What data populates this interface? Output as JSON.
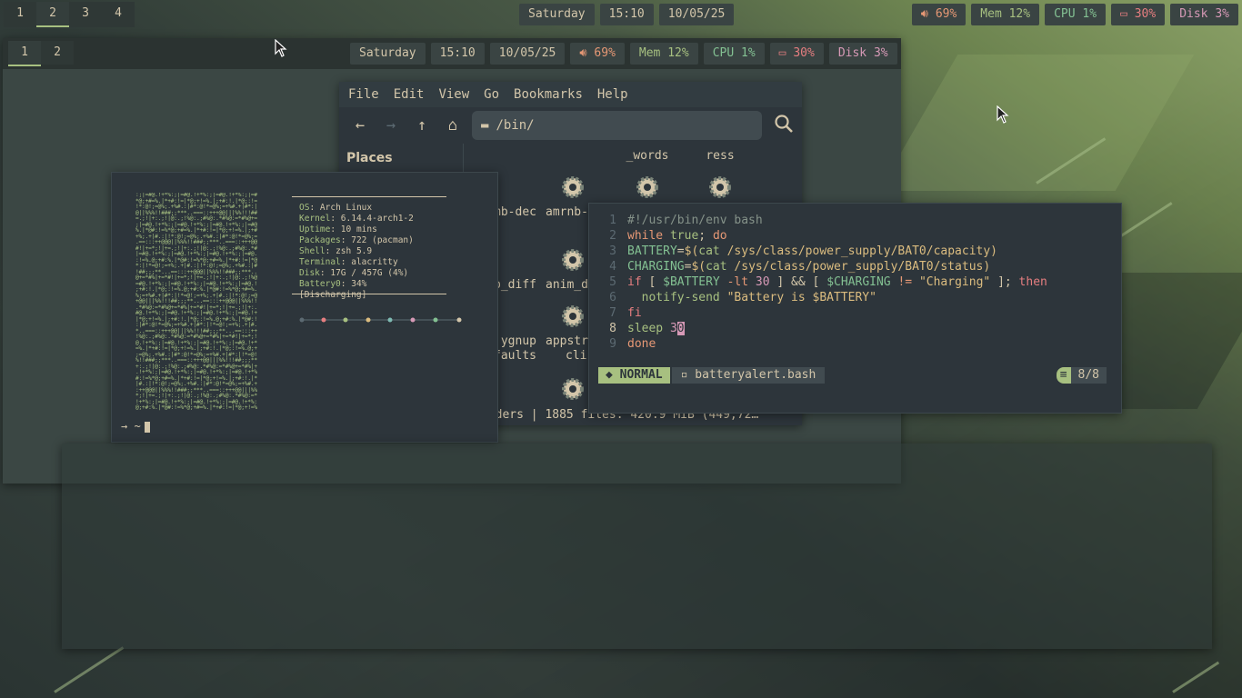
{
  "top_bar": {
    "workspaces": [
      "1",
      "2",
      "3",
      "4"
    ],
    "active_workspace": "2",
    "day": "Saturday",
    "time": "15:10",
    "date": "10/05/25",
    "volume": "69%",
    "mem": "Mem 12%",
    "cpu": "CPU  1%",
    "battery": "30%",
    "disk": "Disk  3%"
  },
  "inner_bar": {
    "workspaces": [
      "1",
      "2"
    ],
    "active_workspace": "1",
    "day": "Saturday",
    "time": "15:10",
    "date": "10/05/25",
    "volume": "69%",
    "mem": "Mem 12%",
    "cpu": "CPU  1%",
    "battery": "30%",
    "disk": "Disk  3%"
  },
  "file_manager": {
    "menu": [
      "File",
      "Edit",
      "View",
      "Go",
      "Bookmarks",
      "Help"
    ],
    "path": "/bin/",
    "sidebar_title": "Places",
    "items": [
      "_words",
      "ress",
      "mb-dec",
      "amrnb-",
      "anim_d",
      "b_diff",
      "ygnup",
      "faults",
      "appstr",
      "cli"
    ],
    "status": "olders  |  1885 files: 420.9 MiB (449,72…"
  },
  "terminal": {
    "info": [
      {
        "k": "OS",
        "v": "Arch Linux"
      },
      {
        "k": "Kernel",
        "v": "6.14.4-arch1-2"
      },
      {
        "k": "Uptime",
        "v": "10 mins"
      },
      {
        "k": "Packages",
        "v": "722 (pacman)"
      },
      {
        "k": "Shell",
        "v": "zsh 5.9"
      },
      {
        "k": "Terminal",
        "v": "alacritty"
      },
      {
        "k": "Disk",
        "v": "17G / 457G (4%)"
      },
      {
        "k": "Battery0",
        "v": "34% [Discharging]"
      }
    ],
    "prompt": "→ ~"
  },
  "editor": {
    "line_numbers": [
      "1",
      "2",
      "3",
      "4",
      "5",
      "6",
      "7",
      "8",
      "9"
    ],
    "mode": "NORMAL",
    "filename": "batteryalert.bash",
    "position": "8/8"
  },
  "colors": {
    "accent": "#a7c080",
    "bg": "#2d353b",
    "fg": "#d3c6aa"
  }
}
